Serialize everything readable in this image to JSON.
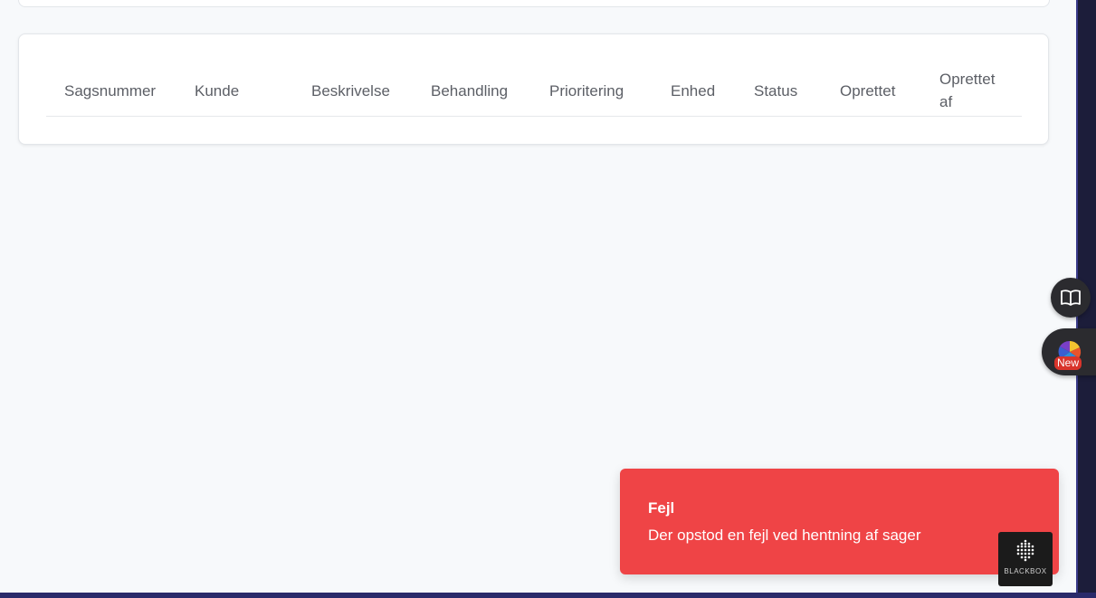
{
  "table": {
    "columns": [
      {
        "label": "Sagsnummer"
      },
      {
        "label": "Kunde"
      },
      {
        "label": "Beskrivelse"
      },
      {
        "label": "Behandling"
      },
      {
        "label": "Prioritering"
      },
      {
        "label": "Enhed"
      },
      {
        "label": "Status"
      },
      {
        "label": "Oprettet"
      },
      {
        "label": "Oprettet af"
      }
    ],
    "rows": []
  },
  "toast": {
    "title": "Fejl",
    "message": "Der opstod en fejl ved hentning af sager",
    "color": "#ef4446"
  },
  "widgets": {
    "reader_icon": "book-open-icon",
    "new_badge": "New",
    "blackbox_label": "BLACKBOX"
  }
}
